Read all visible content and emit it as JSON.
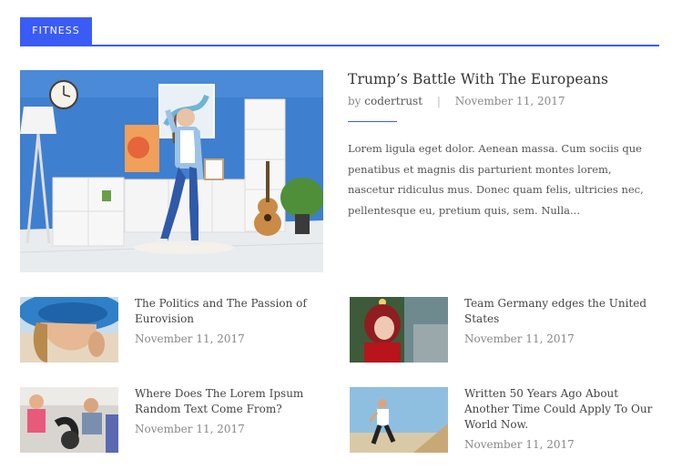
{
  "section": {
    "label": "FITNESS"
  },
  "featured": {
    "title": "Trump’s Battle With The Europeans",
    "by": "by",
    "author": "codertrust",
    "separator": "|",
    "date": "November 11, 2017",
    "excerpt": "Lorem ligula eget dolor. Aenean massa. Cum sociis que penatibus et magnis dis parturient montes lorem, nascetur ridiculus mus. Donec quam felis, ultricies nec, pellentesque eu, pretium quis, sem. Nulla..."
  },
  "posts": [
    {
      "title": "The Politics and The Passion of Eurovision",
      "date": "November 11, 2017"
    },
    {
      "title": "Team Germany edges the United States",
      "date": "November 11, 2017"
    },
    {
      "title": "Where Does The Lorem Ipsum Random Text Come From?",
      "date": "November 11, 2017"
    },
    {
      "title": "Written 50 Years Ago About Another Time Could Apply To Our World Now.",
      "date": "November 11, 2017"
    }
  ]
}
